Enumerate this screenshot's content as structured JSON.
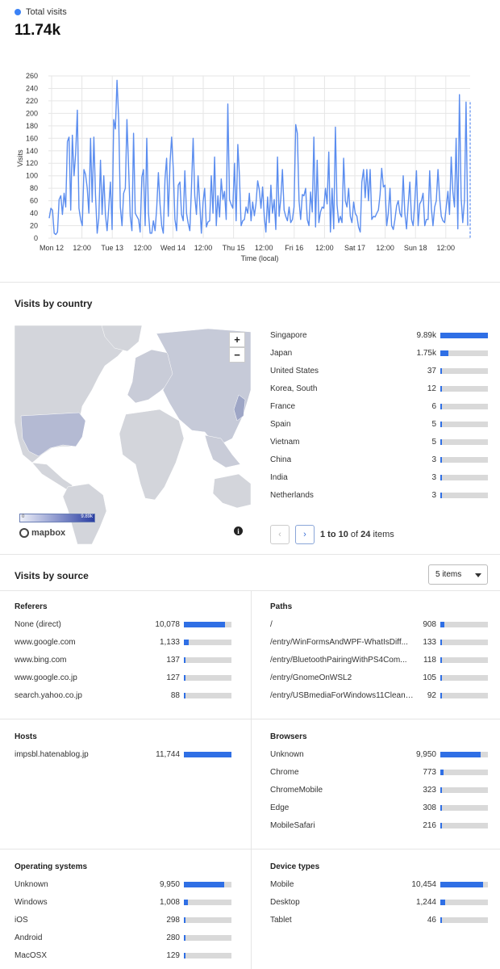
{
  "header": {
    "legend_label": "Total visits",
    "total": "11.74k",
    "accent_color": "#3b82f6"
  },
  "chart_data": {
    "type": "line",
    "title": "",
    "xlabel": "Time (local)",
    "ylabel": "Visits",
    "ylim": [
      0,
      260
    ],
    "yticks": [
      0,
      20,
      40,
      60,
      80,
      100,
      120,
      140,
      160,
      180,
      200,
      220,
      240,
      260
    ],
    "xtick_labels": [
      "Mon 12",
      "12:00",
      "Tue 13",
      "12:00",
      "Wed 14",
      "12:00",
      "Thu 15",
      "12:00",
      "Fri 16",
      "12:00",
      "Sat 17",
      "12:00",
      "Sun 18",
      "12:00"
    ],
    "grid": true,
    "series": [
      {
        "values": [
          32,
          48,
          45,
          8,
          6,
          10,
          62,
          68,
          38,
          72,
          50,
          155,
          162,
          45,
          165,
          100,
          135,
          205,
          48,
          30,
          20,
          110,
          102,
          80,
          40,
          160,
          58,
          162,
          70,
          8,
          32,
          125,
          38,
          100,
          38,
          12,
          48,
          90,
          14,
          190,
          175,
          253,
          190,
          50,
          20,
          72,
          80,
          190,
          112,
          35,
          12,
          168,
          40,
          35,
          30,
          10,
          98,
          110,
          20,
          160,
          40,
          8,
          8,
          28,
          12,
          48,
          105,
          55,
          20,
          8,
          95,
          128,
          35,
          120,
          162,
          110,
          30,
          12,
          85,
          90,
          38,
          28,
          108,
          40,
          24,
          12,
          80,
          160,
          68,
          38,
          100,
          55,
          8,
          58,
          80,
          18,
          26,
          28,
          100,
          40,
          130,
          20,
          68,
          34,
          95,
          62,
          75,
          30,
          215,
          62,
          54,
          48,
          120,
          28,
          150,
          100,
          20,
          28,
          30,
          50,
          40,
          72,
          28,
          58,
          36,
          55,
          92,
          78,
          48,
          82,
          35,
          10,
          66,
          25,
          85,
          40,
          62,
          14,
          130,
          35,
          64,
          110,
          45,
          35,
          28,
          50,
          25,
          30,
          50,
          182,
          168,
          60,
          30,
          70,
          68,
          80,
          30,
          20,
          74,
          42,
          162,
          18,
          125,
          25,
          42,
          50,
          48,
          80,
          55,
          138,
          10,
          80,
          15,
          178,
          54,
          25,
          35,
          25,
          128,
          60,
          50,
          80,
          35,
          25,
          58,
          40,
          35,
          18,
          10,
          90,
          110,
          65,
          110,
          60,
          110,
          30,
          35,
          34,
          40,
          45,
          70,
          112,
          82,
          85,
          20,
          40,
          80,
          20,
          14,
          30,
          52,
          60,
          40,
          34,
          100,
          40,
          15,
          55,
          90,
          30,
          20,
          60,
          108,
          20,
          55,
          60,
          72,
          20,
          30,
          30,
          108,
          48,
          20,
          50,
          60,
          110,
          65,
          35,
          28,
          25,
          50,
          75,
          38,
          130,
          75,
          50,
          160,
          15,
          230,
          65,
          25,
          60,
          218,
          20
        ]
      }
    ],
    "trailing_dashed_value": 218
  },
  "country": {
    "title": "Visits by country",
    "zoom_in": "+",
    "zoom_out": "−",
    "scale_min": "0",
    "scale_max": "9.89k",
    "mapbox": "mapbox",
    "info": "i",
    "rows": [
      {
        "label": "Singapore",
        "value": "9.89k",
        "pct": 1.0
      },
      {
        "label": "Japan",
        "value": "1.75k",
        "pct": 0.177
      },
      {
        "label": "United States",
        "value": "37",
        "pct": 0.004
      },
      {
        "label": "Korea, South",
        "value": "12",
        "pct": 0.002
      },
      {
        "label": "France",
        "value": "6",
        "pct": 0.001
      },
      {
        "label": "Spain",
        "value": "5",
        "pct": 0.001
      },
      {
        "label": "Vietnam",
        "value": "5",
        "pct": 0.001
      },
      {
        "label": "China",
        "value": "3",
        "pct": 0.001
      },
      {
        "label": "India",
        "value": "3",
        "pct": 0.001
      },
      {
        "label": "Netherlands",
        "value": "3",
        "pct": 0.001
      }
    ],
    "pagination": {
      "prev": "‹",
      "next": "›",
      "range": "1 to 10",
      "of": "of",
      "total": "24",
      "items": "items"
    }
  },
  "source": {
    "title": "Visits by source",
    "select_value": "5 items",
    "referers": {
      "title": "Referers",
      "rows": [
        {
          "label": "None (direct)",
          "value": "10,078",
          "pct": 0.87
        },
        {
          "label": "www.google.com",
          "value": "1,133",
          "pct": 0.1
        },
        {
          "label": "www.bing.com",
          "value": "137",
          "pct": 0.012
        },
        {
          "label": "www.google.co.jp",
          "value": "127",
          "pct": 0.011
        },
        {
          "label": "search.yahoo.co.jp",
          "value": "88",
          "pct": 0.008
        }
      ]
    },
    "paths": {
      "title": "Paths",
      "rows": [
        {
          "label": "/",
          "value": "908",
          "pct": 0.078
        },
        {
          "label": "/entry/WinFormsAndWPF-WhatIsDiff...",
          "value": "133",
          "pct": 0.012
        },
        {
          "label": "/entry/BluetoothPairingWithPS4Com...",
          "value": "118",
          "pct": 0.01
        },
        {
          "label": "/entry/GnomeOnWSL2",
          "value": "105",
          "pct": 0.009
        },
        {
          "label": "/entry/USBmediaForWindows11Cleanl...",
          "value": "92",
          "pct": 0.008
        }
      ]
    },
    "hosts": {
      "title": "Hosts",
      "rows": [
        {
          "label": "impsbl.hatenablog.jp",
          "value": "11,744",
          "pct": 1.0
        }
      ]
    },
    "browsers": {
      "title": "Browsers",
      "rows": [
        {
          "label": "Unknown",
          "value": "9,950",
          "pct": 0.85
        },
        {
          "label": "Chrome",
          "value": "773",
          "pct": 0.066
        },
        {
          "label": "ChromeMobile",
          "value": "323",
          "pct": 0.028
        },
        {
          "label": "Edge",
          "value": "308",
          "pct": 0.026
        },
        {
          "label": "MobileSafari",
          "value": "216",
          "pct": 0.018
        }
      ]
    },
    "os": {
      "title": "Operating systems",
      "rows": [
        {
          "label": "Unknown",
          "value": "9,950",
          "pct": 0.85
        },
        {
          "label": "Windows",
          "value": "1,008",
          "pct": 0.086
        },
        {
          "label": "iOS",
          "value": "298",
          "pct": 0.025
        },
        {
          "label": "Android",
          "value": "280",
          "pct": 0.024
        },
        {
          "label": "MacOSX",
          "value": "129",
          "pct": 0.011
        }
      ]
    },
    "devices": {
      "title": "Device types",
      "rows": [
        {
          "label": "Mobile",
          "value": "10,454",
          "pct": 0.89
        },
        {
          "label": "Desktop",
          "value": "1,244",
          "pct": 0.106
        },
        {
          "label": "Tablet",
          "value": "46",
          "pct": 0.004
        }
      ]
    }
  }
}
